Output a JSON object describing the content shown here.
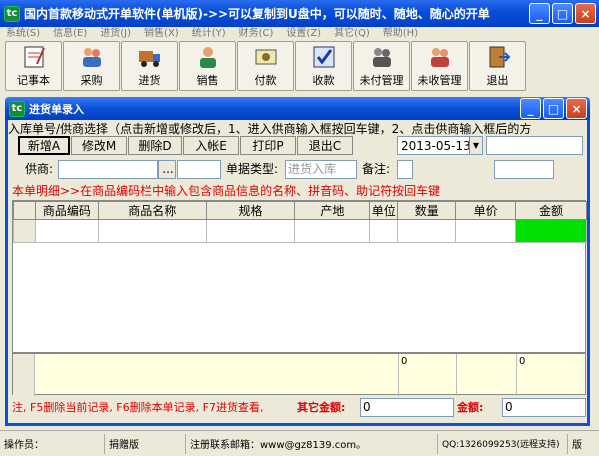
{
  "app": {
    "title": "国内首款移动式开单软件(单机版)->>可以复制到U盘中，可以随时、随地、随心的开单",
    "icon": "tc"
  },
  "menu": [
    "系统(S)",
    "信息(E)",
    "进货(J)",
    "销售(X)",
    "统计(Y)",
    "财务(C)",
    "设置(Z)",
    "其它(Q)",
    "帮助(H)"
  ],
  "toolbar": [
    "记事本",
    "采购",
    "进货",
    "销售",
    "付款",
    "收款",
    "未付管理",
    "未收管理",
    "退出"
  ],
  "window": {
    "title": "进货单录入"
  },
  "hint": "入库单号/供商选择（点击新增或修改后，1、进入供商输入框按回车键，2、点击供商输入框后的方",
  "actions": [
    "新增A",
    "修改M",
    "删除D",
    "入帐E",
    "打印P",
    "退出C"
  ],
  "date": "2013-05-13",
  "supplier_label": "供商:",
  "supplier_btn": "...",
  "doc_type_label": "单据类型:",
  "doc_type_value": "进货入库",
  "note_label": "备注:",
  "detail_hint": "本单明细>>在商品编码栏中输入包含商品信息的名称、拼音码、助记符按回车键",
  "columns": [
    "商品编码",
    "商品名称",
    "规格",
    "产地",
    "单位",
    "数量",
    "单价",
    "金额"
  ],
  "sum_qty": "0",
  "sum_amount": "0",
  "footer": {
    "note": "注, F5删除当前记录, F6删除本单记录, F7进货查看,",
    "other_amount_label": "其它金额:",
    "other_amount_value": "0",
    "amount_label": "金额:",
    "amount_value": "0"
  },
  "status": {
    "operator": "操作员：",
    "edition": "捐赠版",
    "email": "注册联系邮箱：www@gz8139.com。",
    "qq": "QQ:1326099253(远程支持)",
    "ver": "版"
  },
  "colors": {
    "accent": "#0a50d8",
    "highlight": "#00e000",
    "red": "#e00000"
  }
}
